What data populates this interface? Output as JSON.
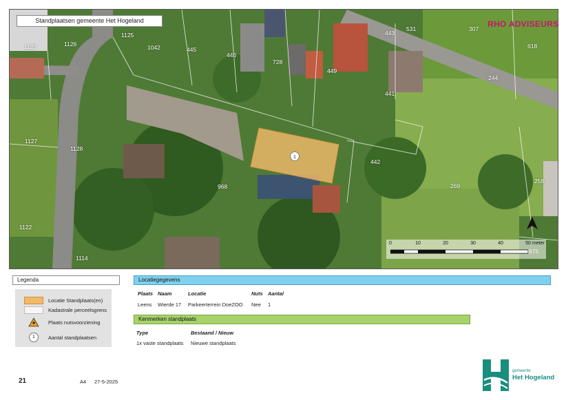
{
  "map": {
    "title": "Standplaatsen gemeente Het Hogeland",
    "brand": "RHO ADVISEURS",
    "location_marker": "1",
    "parcels": [
      "1123",
      "1126",
      "1125",
      "1042",
      "445",
      "446",
      "728",
      "449",
      "443",
      "531",
      "307",
      "618",
      "244",
      "441",
      "1127",
      "1128",
      "442",
      "968",
      "269",
      "258",
      "1122",
      "1114",
      "975"
    ],
    "scale": {
      "ticks": [
        "0",
        "10",
        "20",
        "30",
        "40",
        "50"
      ],
      "unit": "meter"
    },
    "north_icon": "north-arrow-icon"
  },
  "legend": {
    "title": "Legenda",
    "items": [
      {
        "label": "Locatie Standplaats(en)",
        "symbol": "orange-swatch"
      },
      {
        "label": "Kadastrale perceelsgrens",
        "symbol": "white-swatch"
      },
      {
        "label": "Plaats nutsvoorziening",
        "symbol": "warning-icon"
      },
      {
        "label": "Aantal standplaatsen",
        "symbol": "1"
      }
    ]
  },
  "locatie": {
    "title": "Locatiegegevens",
    "headers": {
      "plaats": "Plaats",
      "naam": "Naam",
      "locatie": "Locatie",
      "nuts": "Nuts",
      "aantal": "Aantal"
    },
    "row": {
      "plaats": "Leens",
      "naam": "Wierde 17",
      "locatie": "Parkeerterrein DoeZOO",
      "nuts": "Nee",
      "aantal": "1"
    }
  },
  "kenmerken": {
    "title": "Kenmerken standplaats",
    "headers": {
      "type": "Type",
      "bestaand": "Bestaand / Nieuw"
    },
    "row": {
      "type": "1x vaste standplaats",
      "bestaand": "Nieuwe standplaats"
    }
  },
  "footer": {
    "page": "21",
    "format": "A4",
    "date": "27-5-2025"
  },
  "logo": {
    "sub": "gemeente",
    "name": "Het Hogeland"
  },
  "colors": {
    "location": "#f2b96a",
    "blue_header": "#7fd0ee",
    "green_header": "#a8d26b",
    "brand": "#c2186b",
    "logo": "#1a8e7e"
  }
}
